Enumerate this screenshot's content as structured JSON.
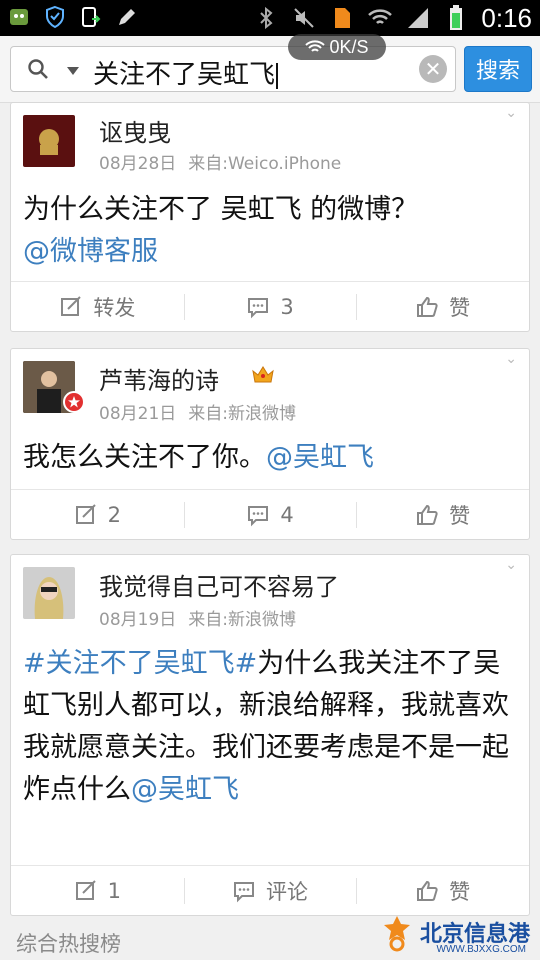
{
  "status_bar": {
    "time": "0:16",
    "network_speed": "0K/S"
  },
  "search": {
    "query": "关注不了吴虹飞",
    "button_label": "搜索"
  },
  "posts": [
    {
      "author": "讴曳曳",
      "date": "08月28日",
      "source": "来自:Weico.iPhone",
      "text_plain": "为什么关注不了 吴虹飞 的微博？",
      "mention": "@微博客服",
      "actions": {
        "repost": "转发",
        "comment": "3",
        "like": "赞"
      }
    },
    {
      "author": "芦苇海的诗",
      "date": "08月21日",
      "source": "来自:新浪微博",
      "text_plain": "我怎么关注不了你。",
      "mention": "@吴虹飞",
      "actions": {
        "repost": "2",
        "comment": "4",
        "like": "赞"
      }
    },
    {
      "author": "我觉得自己可不容易了",
      "date": "08月19日",
      "source": "来自:新浪微博",
      "topic": "#关注不了吴虹飞#",
      "text_plain": "为什么我关注不了吴虹飞别人都可以，新浪给解释，我就喜欢我就愿意关注。我们还要考虑是不是一起炸点什么",
      "mention": "@吴虹飞",
      "actions": {
        "repost": "1",
        "comment": "评论",
        "like": "赞"
      }
    }
  ],
  "footer": {
    "section_label": "综合热搜榜"
  },
  "watermark": {
    "text": "北京信息港",
    "url": "WWW.BJXXG.COM"
  },
  "colors": {
    "link": "#3d7fbf",
    "search_button": "#2d8fe0",
    "meta": "#9a9a9a"
  }
}
